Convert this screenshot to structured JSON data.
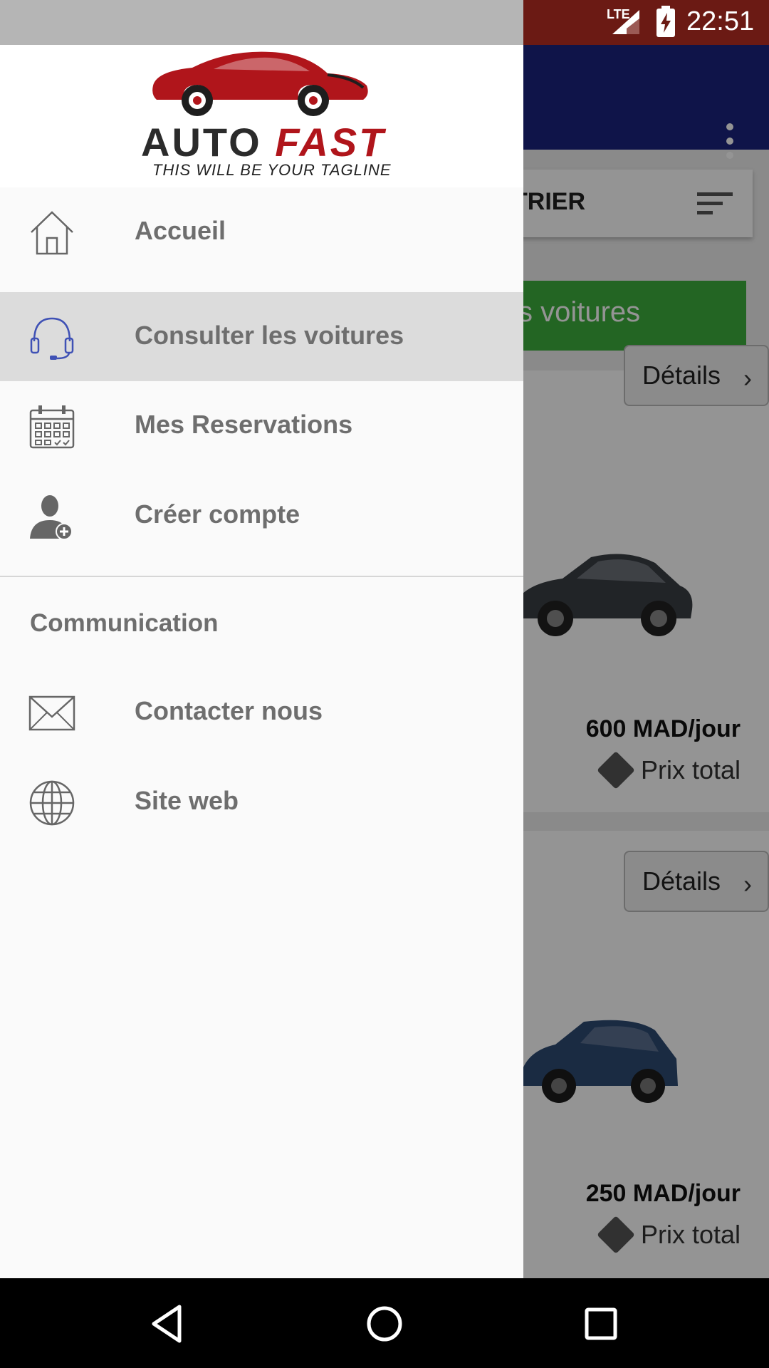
{
  "status_bar": {
    "network": "LTE",
    "time": "22:51"
  },
  "background_app": {
    "sort_label": "TRIER",
    "green_button_label": "s voitures",
    "cars": [
      {
        "price": "600 MAD/jour",
        "total_label": "Prix total",
        "details_label": "Détails",
        "color": "#3a3e44"
      },
      {
        "price": "250 MAD/jour",
        "total_label": "Prix total",
        "details_label": "Détails",
        "color": "#2d4a73"
      }
    ]
  },
  "drawer": {
    "logo": {
      "auto": "AUTO",
      "fast": "FAST",
      "tagline": "THIS WILL BE YOUR TAGLINE"
    },
    "items": [
      {
        "label": "Accueil",
        "icon": "home-icon"
      },
      {
        "label": "Consulter les voitures",
        "icon": "headset-icon",
        "active": true
      },
      {
        "label": "Mes Reservations",
        "icon": "calendar-icon"
      },
      {
        "label": "Créer compte",
        "icon": "add-user-icon"
      }
    ],
    "section_title": "Communication",
    "section_items": [
      {
        "label": "Contacter nous",
        "icon": "envelope-icon"
      },
      {
        "label": "Site web",
        "icon": "globe-icon"
      }
    ]
  },
  "nav_bar": {
    "back": "back-icon",
    "home": "home-circle-icon",
    "recents": "recents-icon"
  },
  "colors": {
    "app_bar": "#1a237e",
    "accent_green": "#3dae3d",
    "brand_red": "#b0151b",
    "active_item": "#dcdcdc",
    "headset_icon": "#3f51b5"
  }
}
